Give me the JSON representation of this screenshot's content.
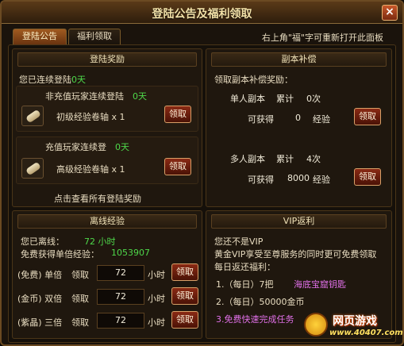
{
  "window": {
    "title": "登陆公告及福利领取",
    "close_label": "×"
  },
  "tabs": [
    {
      "label": "登陆公告",
      "active": true
    },
    {
      "label": "福利领取",
      "active": false
    }
  ],
  "hint": "右上角\"福\"字可重新打开此面板",
  "login_rewards": {
    "header": "登陆奖励",
    "consecutive_label": "您已连续登陆",
    "consecutive_value": "0天",
    "non_recharge_label": "非充值玩家连续登陆",
    "non_recharge_value": "0天",
    "item1": "初级经验卷轴 x 1",
    "recharge_label": "充值玩家连续登",
    "recharge_value": "0天",
    "item2": "高级经验卷轴 x 1",
    "claim": "领取",
    "view_all": "点击查看所有登陆奖励"
  },
  "dungeon_comp": {
    "header": "副本补偿",
    "claim_label": "领取副本补偿奖励：",
    "single": {
      "name": "单人副本",
      "cum_label": "累计",
      "count": "0次",
      "obtain_label": "可获得",
      "value": "0",
      "unit": "经验"
    },
    "multi": {
      "name": "多人副本",
      "cum_label": "累计",
      "count": "4次",
      "obtain_label": "可获得",
      "value": "8000",
      "unit": "经验"
    },
    "claim": "领取"
  },
  "offline_exp": {
    "header": "离线经验",
    "offline_label": "您已离线：",
    "offline_value": "72 小时",
    "exp_label": "免费获得单倍经验：",
    "exp_value": "1053907",
    "rows": [
      {
        "type": "(免费) 单倍",
        "action": "领取",
        "hours": "72",
        "unit": "小时",
        "button": "领取"
      },
      {
        "type": "(金币) 双倍",
        "action": "领取",
        "hours": "72",
        "unit": "小时",
        "button": "领取"
      },
      {
        "type": "(紫晶) 三倍",
        "action": "领取",
        "hours": "72",
        "unit": "小时",
        "button": "领取"
      }
    ]
  },
  "vip": {
    "header": "VIP返利",
    "status": "您还不是VIP",
    "desc": "黄金VIP享受至尊服务的同时更可免费领取",
    "daily_title": "每日返还福利：",
    "item1_prefix": "1.（每日）7把",
    "item1_highlight": "海底宝窟钥匙",
    "item2": "2.（每日）50000金币",
    "item3": "3.免费快速完成任务"
  },
  "watermark": {
    "brand": "网页游戏",
    "url": "www.40407.com"
  }
}
